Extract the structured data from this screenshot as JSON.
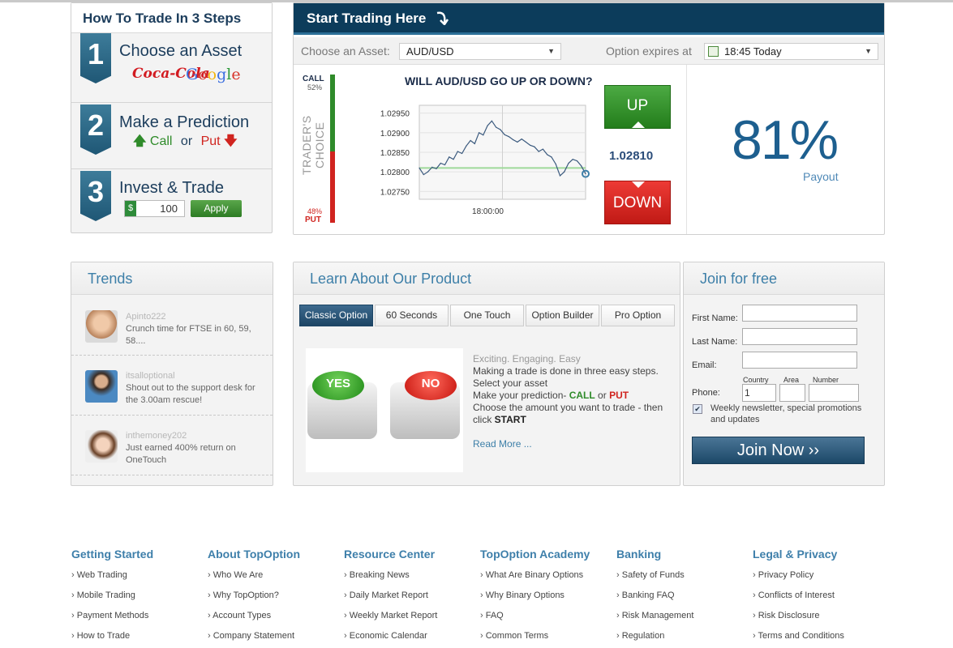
{
  "steps": {
    "title": "How To Trade In 3 Steps",
    "items": [
      {
        "num": "1",
        "title": "Choose an Asset"
      },
      {
        "num": "2",
        "title": "Make a Prediction"
      },
      {
        "num": "3",
        "title": "Invest & Trade"
      }
    ],
    "brands": [
      "Coca-Cola",
      "Google"
    ],
    "call_label": "Call",
    "or_label": "or",
    "put_label": "Put",
    "currency_symbol": "$",
    "amount": "100",
    "apply_label": "Apply"
  },
  "trading": {
    "title": "Start Trading Here",
    "asset_label": "Choose an Asset:",
    "asset_value": "AUD/USD",
    "expiry_label": "Option expires at",
    "expiry_value": "18:45 Today",
    "call_label": "CALL",
    "call_pct": "52%",
    "put_pct": "48%",
    "put_label": "PUT",
    "traders_choice": "TRADER'S CHOICE",
    "question": "WILL AUD/USD GO UP OR DOWN?",
    "current_price": "1.02810",
    "up_label": "UP",
    "down_label": "DOWN",
    "payout_value": "81%",
    "payout_label": "Payout",
    "call_fraction": 0.52
  },
  "chart_data": {
    "type": "line",
    "y_ticks": [
      "1.02950",
      "1.02900",
      "1.02850",
      "1.02800",
      "1.02750"
    ],
    "ylim": [
      1.0273,
      1.0297
    ],
    "x_tick": "18:00:00",
    "strike": 1.0281,
    "series": [
      {
        "values": [
          1.0281,
          1.02793,
          1.028,
          1.02812,
          1.02808,
          1.02822,
          1.02818,
          1.02838,
          1.02832,
          1.02852,
          1.02847,
          1.02866,
          1.0288,
          1.02872,
          1.029,
          1.02894,
          1.02918,
          1.0293,
          1.02914,
          1.02908,
          1.02895,
          1.0289,
          1.02882,
          1.02876,
          1.02884,
          1.02876,
          1.02868,
          1.02864,
          1.02852,
          1.02858,
          1.02844,
          1.02838,
          1.0282,
          1.0279,
          1.028,
          1.02822,
          1.02832,
          1.02828,
          1.02815,
          1.02795
        ]
      }
    ]
  },
  "trends": {
    "title": "Trends",
    "items": [
      {
        "user": "Apinto222",
        "text": "Crunch time for FTSE in 60, 59, 58...."
      },
      {
        "user": "itsalloptional",
        "text": "Shout out to the support desk for the 3.00am rescue!"
      },
      {
        "user": "inthemoney202",
        "text": "Just earned 400% return on OneTouch"
      }
    ]
  },
  "learn": {
    "title": "Learn About Our Product",
    "tabs": [
      "Classic Option",
      "60 Seconds",
      "One Touch",
      "Option Builder",
      "Pro Option"
    ],
    "yes_label": "YES",
    "no_label": "NO",
    "headline": "Exciting. Engaging. Easy",
    "line1": "Making a trade is done in three easy steps.",
    "line2": "Select your asset",
    "line3_pre": "Make your prediction- ",
    "line3_call": "CALL",
    "line3_or": " or ",
    "line3_put": "PUT",
    "line4": "Choose the amount you want to trade - then click ",
    "line4_start": "START",
    "read_more": "Read More ..."
  },
  "join": {
    "title": "Join for free",
    "first_name": "First Name:",
    "last_name": "Last Name:",
    "email": "Email:",
    "phone": "Phone:",
    "country": "Country",
    "area": "Area",
    "number": "Number",
    "country_value": "1",
    "newsletter": "Weekly newsletter, special promotions and updates",
    "join_label": "Join Now ››"
  },
  "footer": [
    {
      "heading": "Getting Started",
      "links": [
        "Web Trading",
        "Mobile Trading",
        "Payment Methods",
        "How to Trade"
      ]
    },
    {
      "heading": "About TopOption",
      "links": [
        "Who We Are",
        "Why TopOption?",
        "Account Types",
        "Company Statement"
      ]
    },
    {
      "heading": "Resource Center",
      "links": [
        "Breaking News",
        "Daily Market Report",
        "Weekly Market Report",
        "Economic Calendar"
      ]
    },
    {
      "heading": "TopOption Academy",
      "links": [
        "What Are Binary Options",
        "Why Binary Options",
        "FAQ",
        "Common Terms"
      ]
    },
    {
      "heading": "Banking",
      "links": [
        "Safety of Funds",
        "Banking FAQ",
        "Risk Management",
        "Regulation"
      ]
    },
    {
      "heading": "Legal & Privacy",
      "links": [
        "Privacy Policy",
        "Conflicts of Interest",
        "Risk Disclosure",
        "Terms and Conditions"
      ]
    }
  ],
  "colors": {
    "brand": "#0c3c5b",
    "accent": "#3d7fa8",
    "up": "#2f8b2a",
    "down": "#d0241f"
  }
}
